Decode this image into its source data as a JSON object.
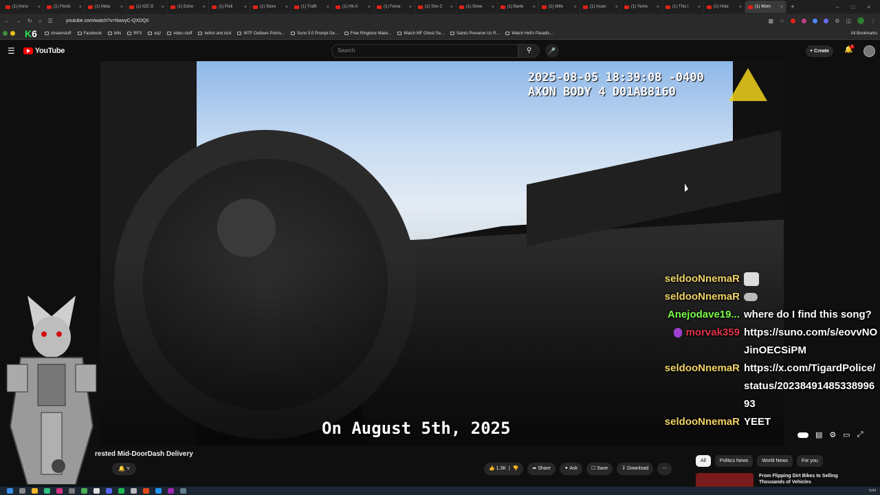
{
  "browser": {
    "tabs": [
      {
        "label": "(1) Anno"
      },
      {
        "label": "(1) Florid"
      },
      {
        "label": "(1) Mela"
      },
      {
        "label": "(1) ICE O"
      },
      {
        "label": "(1) Extre"
      },
      {
        "label": "(1) Pulli"
      },
      {
        "label": "(1) Store"
      },
      {
        "label": "(1) Traffi"
      },
      {
        "label": "(1) Hit-A"
      },
      {
        "label": "(1) Fema"
      },
      {
        "label": "(1) She C"
      },
      {
        "label": "(1) Stree"
      },
      {
        "label": "(1) Barte"
      },
      {
        "label": "(1) Wife"
      },
      {
        "label": "(1) Insan"
      },
      {
        "label": "(1) Yeme"
      },
      {
        "label": "(1) This I"
      },
      {
        "label": "(1) Hote"
      },
      {
        "label": "(1) Wom"
      }
    ],
    "url": "youtube.com/watch?v=NwvyC-QXDQ0",
    "bookmarks": [
      "streamstuff",
      "Facebook",
      "bills",
      "RFS",
      "eq2",
      "video stuff",
      "twitch and kick",
      "WTF Outlaws Points...",
      "Suno 5.0 Prompt Ge...",
      "Free Ringtone Make...",
      "Watch MF Ghost Se...",
      "Saints Preserve Us R...",
      "Watch Hell's Paradis..."
    ],
    "bookmarks_right": "All Bookmarks",
    "k6_logo": {
      "k": "K",
      "six": "6"
    }
  },
  "youtube": {
    "logo_text": "YouTube",
    "search_placeholder": "Search",
    "create_label": "Create",
    "notification_count": "1"
  },
  "video": {
    "timestamp_line1": "2025-08-05 18:39:08 -0400",
    "timestamp_line2": "AXON BODY 4 D01AB8160",
    "caption": "On August 5th, 2025",
    "title": "rested Mid-DoorDash Delivery"
  },
  "chat": [
    {
      "user": "seldooNnemaR",
      "color": "#f2d466",
      "text": "",
      "emote": "face"
    },
    {
      "user": "seldooNnemaR",
      "color": "#f2d466",
      "text": "",
      "emote": "small"
    },
    {
      "user": "Anejodave19...",
      "color": "#7cff4a",
      "text": "where do I find this song?"
    },
    {
      "user": "morvak359",
      "color": "#e0334a",
      "text": "https://suno.com/s/eovvNOJinOECSiPM",
      "mic": true
    },
    {
      "user": "seldooNnemaR",
      "color": "#f2d466",
      "text": "https://x.com/TigardPolice/status/2023849148533899693"
    },
    {
      "user": "seldooNnemaR",
      "color": "#f2d466",
      "text": "YEET"
    }
  ],
  "actions": {
    "like_count": "1.3K",
    "share_label": "Share",
    "ask_label": "Ask",
    "save_label": "Save",
    "download_label": "Download",
    "more_label": "⋯"
  },
  "chips": [
    "All",
    "Politics News",
    "World News",
    "For you"
  ],
  "recommended": {
    "title": "From Flipping Dirt Bikes to Selling Thousands of Vehicles"
  },
  "taskbar": {
    "clock": "5:04"
  }
}
